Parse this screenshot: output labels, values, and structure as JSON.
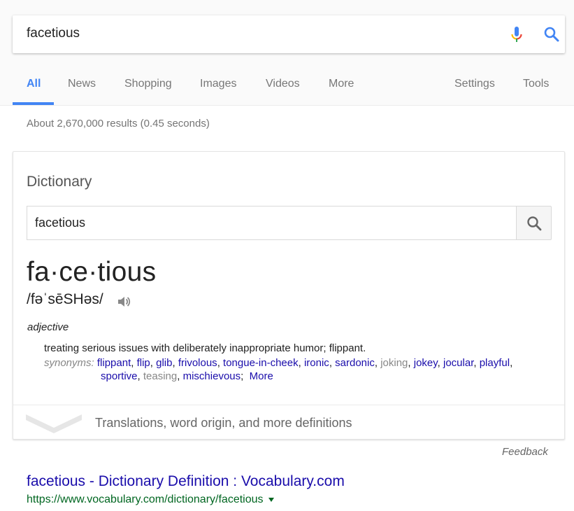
{
  "search": {
    "query": "facetious",
    "mic_icon": "microphone-icon",
    "search_icon": "search-icon"
  },
  "tabs": [
    {
      "label": "All",
      "active": true
    },
    {
      "label": "News"
    },
    {
      "label": "Shopping"
    },
    {
      "label": "Images"
    },
    {
      "label": "Videos"
    },
    {
      "label": "More"
    },
    {
      "label": "Settings"
    },
    {
      "label": "Tools"
    }
  ],
  "stats": "About 2,670,000 results (0.45 seconds)",
  "dictionary": {
    "title": "Dictionary",
    "input_value": "facetious",
    "headword": "fa·ce·tious",
    "phonetic": "/fəˈsēSHəs/",
    "part_of_speech": "adjective",
    "definition": "treating serious issues with deliberately inappropriate humor; flippant.",
    "synonyms_label": "synonyms:",
    "synonyms_line1": [
      {
        "word": "flippant",
        "link": true
      },
      {
        "word": "flip",
        "link": true
      },
      {
        "word": "glib",
        "link": true
      },
      {
        "word": "frivolous",
        "link": true
      },
      {
        "word": "tongue-in-cheek",
        "link": true
      },
      {
        "word": "ironic",
        "link": true
      },
      {
        "word": "sardonic",
        "link": true
      },
      {
        "word": "joking",
        "link": false
      },
      {
        "word": "jokey",
        "link": true
      },
      {
        "word": "jocular",
        "link": true
      },
      {
        "word": "playful",
        "link": true
      }
    ],
    "synonyms_line2": [
      {
        "word": "sportive",
        "link": true
      },
      {
        "word": "teasing",
        "link": false
      },
      {
        "word": "mischievous",
        "link": true
      }
    ],
    "more_label": "More",
    "expand_label": "Translations, word origin, and more definitions"
  },
  "feedback": "Feedback",
  "result": {
    "title": "facetious - Dictionary Definition : Vocabulary.com",
    "url": "https://www.vocabulary.com/dictionary/facetious"
  },
  "colors": {
    "accent": "#4285f4",
    "link": "#1a0dab",
    "url": "#006621"
  }
}
